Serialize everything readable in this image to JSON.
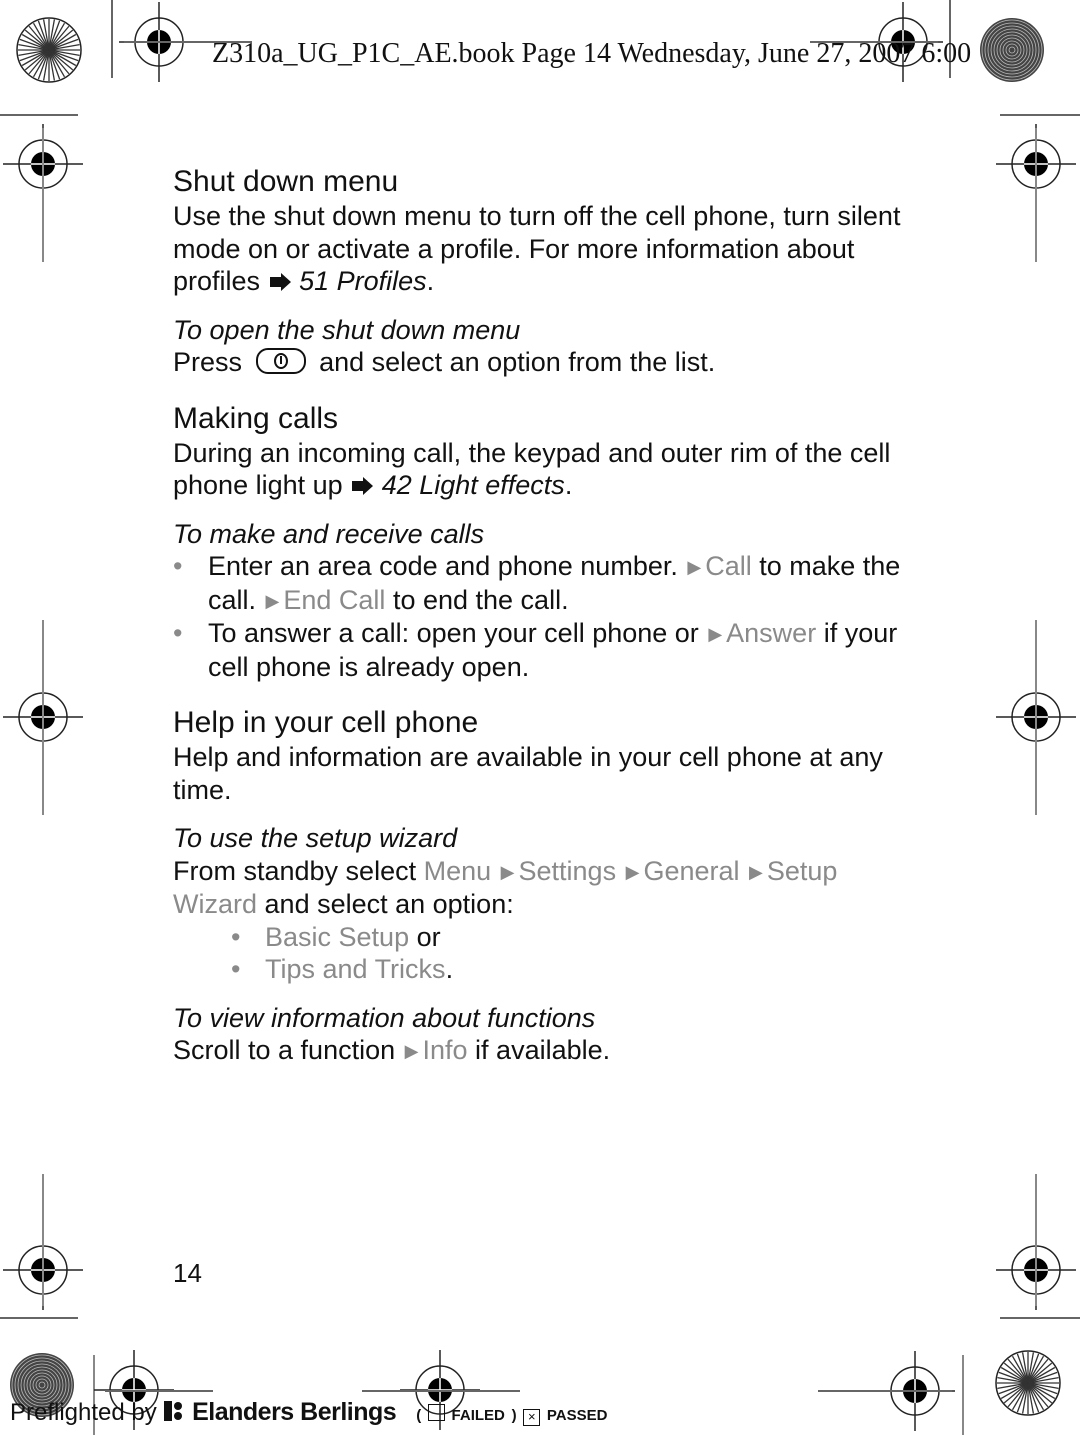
{
  "header": {
    "slug": "Z310a_UG_P1C_AE.book  Page 14  Wednesday, June 27, 2007  6:00"
  },
  "sections": {
    "shutdown": {
      "title": "Shut down menu",
      "body_prefix": "Use the shut down menu to turn off the cell phone, turn silent mode on or activate a profile. For more information about profiles",
      "ref": "51 Profiles",
      "ref_suffix": ".",
      "sub_title": "To open the shut down menu",
      "instruction_prefix": "Press",
      "key_icon": "power-key-icon",
      "instruction_suffix": "and select an option from the list."
    },
    "calls": {
      "title": "Making calls",
      "body_prefix": "During an incoming call, the keypad and outer rim of the cell phone light up",
      "ref": "42 Light effects",
      "ref_suffix": ".",
      "sub_title": "To make and receive calls",
      "bullets": [
        {
          "t1": "Enter an area code and phone number.",
          "m1": "Call",
          "t2": "to make the call.",
          "m2": "End Call",
          "t3": "to end the call."
        },
        {
          "t1": "To answer a call: open your cell phone or",
          "m1": "Answer",
          "t2": "if your cell phone is already open."
        }
      ]
    },
    "help": {
      "title": "Help in your cell phone",
      "body": "Help and information are available in your cell phone at any time.",
      "wizard_title": "To use the setup wizard",
      "wizard_prefix": "From standby select",
      "wizard_path": [
        "Menu",
        "Settings",
        "General",
        "Setup Wizard"
      ],
      "wizard_suffix": "and select an option:",
      "options": [
        {
          "label": "Basic Setup",
          "suffix": " or"
        },
        {
          "label": "Tips and Tricks",
          "suffix": "."
        }
      ],
      "info_title": "To view information about functions",
      "info_prefix": "Scroll to a function",
      "info_menu": "Info",
      "info_suffix": "if available."
    }
  },
  "page_number": "14",
  "footer": {
    "preflighted_by": "Preflighted by",
    "brand": "Elanders Berlings",
    "open_paren": "(",
    "failed_label": "FAILED",
    "close_paren": ")",
    "passed_mark": "×",
    "passed_label": "PASSED"
  },
  "colors": {
    "menu_grey": "#8a8a8a",
    "text": "#111111"
  }
}
